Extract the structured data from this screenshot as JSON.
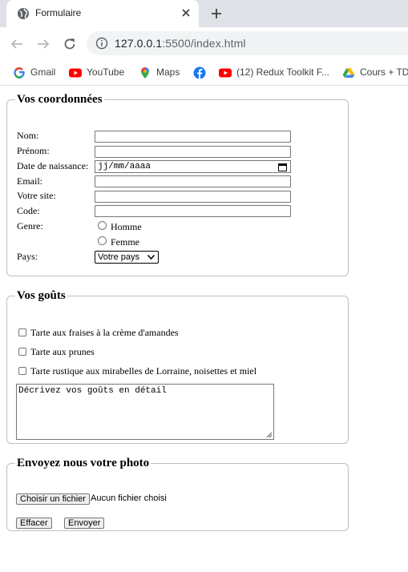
{
  "browser": {
    "tab_title": "Formulaire",
    "url_host": "127.0.0.1",
    "url_rest": ":5500/index.html",
    "bookmarks": [
      {
        "label": "Gmail",
        "icon": "gmail-icon"
      },
      {
        "label": "YouTube",
        "icon": "youtube-icon"
      },
      {
        "label": "Maps",
        "icon": "maps-icon"
      },
      {
        "label": "",
        "icon": "facebook-icon"
      },
      {
        "label": "(12) Redux Toolkit F...",
        "icon": "youtube-icon"
      },
      {
        "label": "Cours + TD",
        "icon": "drive-icon"
      }
    ]
  },
  "coordonnees": {
    "legend": "Vos coordonnées",
    "nom": "Nom:",
    "prenom": "Prénom:",
    "naissance": "Date de naissance:",
    "date_placeholder": "jj/mm/aaaa",
    "email": "Email:",
    "site": "Votre site:",
    "code": "Code:",
    "genre": "Genre:",
    "homme": "Homme",
    "femme": "Femme",
    "pays": "Pays:",
    "pays_selected": "Votre pays"
  },
  "gouts": {
    "legend": "Vos goûts",
    "options": [
      "Tarte aux fraises à la crème d'amandes",
      "Tarte aux prunes",
      "Tarte rustique aux mirabelles de Lorraine, noisettes et miel"
    ],
    "textarea_text": "Décrivez vos goûts en détail"
  },
  "photo": {
    "legend": "Envoyez nous votre photo",
    "choose_label": "Choisir un fichier",
    "no_file": "Aucun fichier choisi",
    "reset_label": "Effacer",
    "submit_label": "Envoyer"
  }
}
